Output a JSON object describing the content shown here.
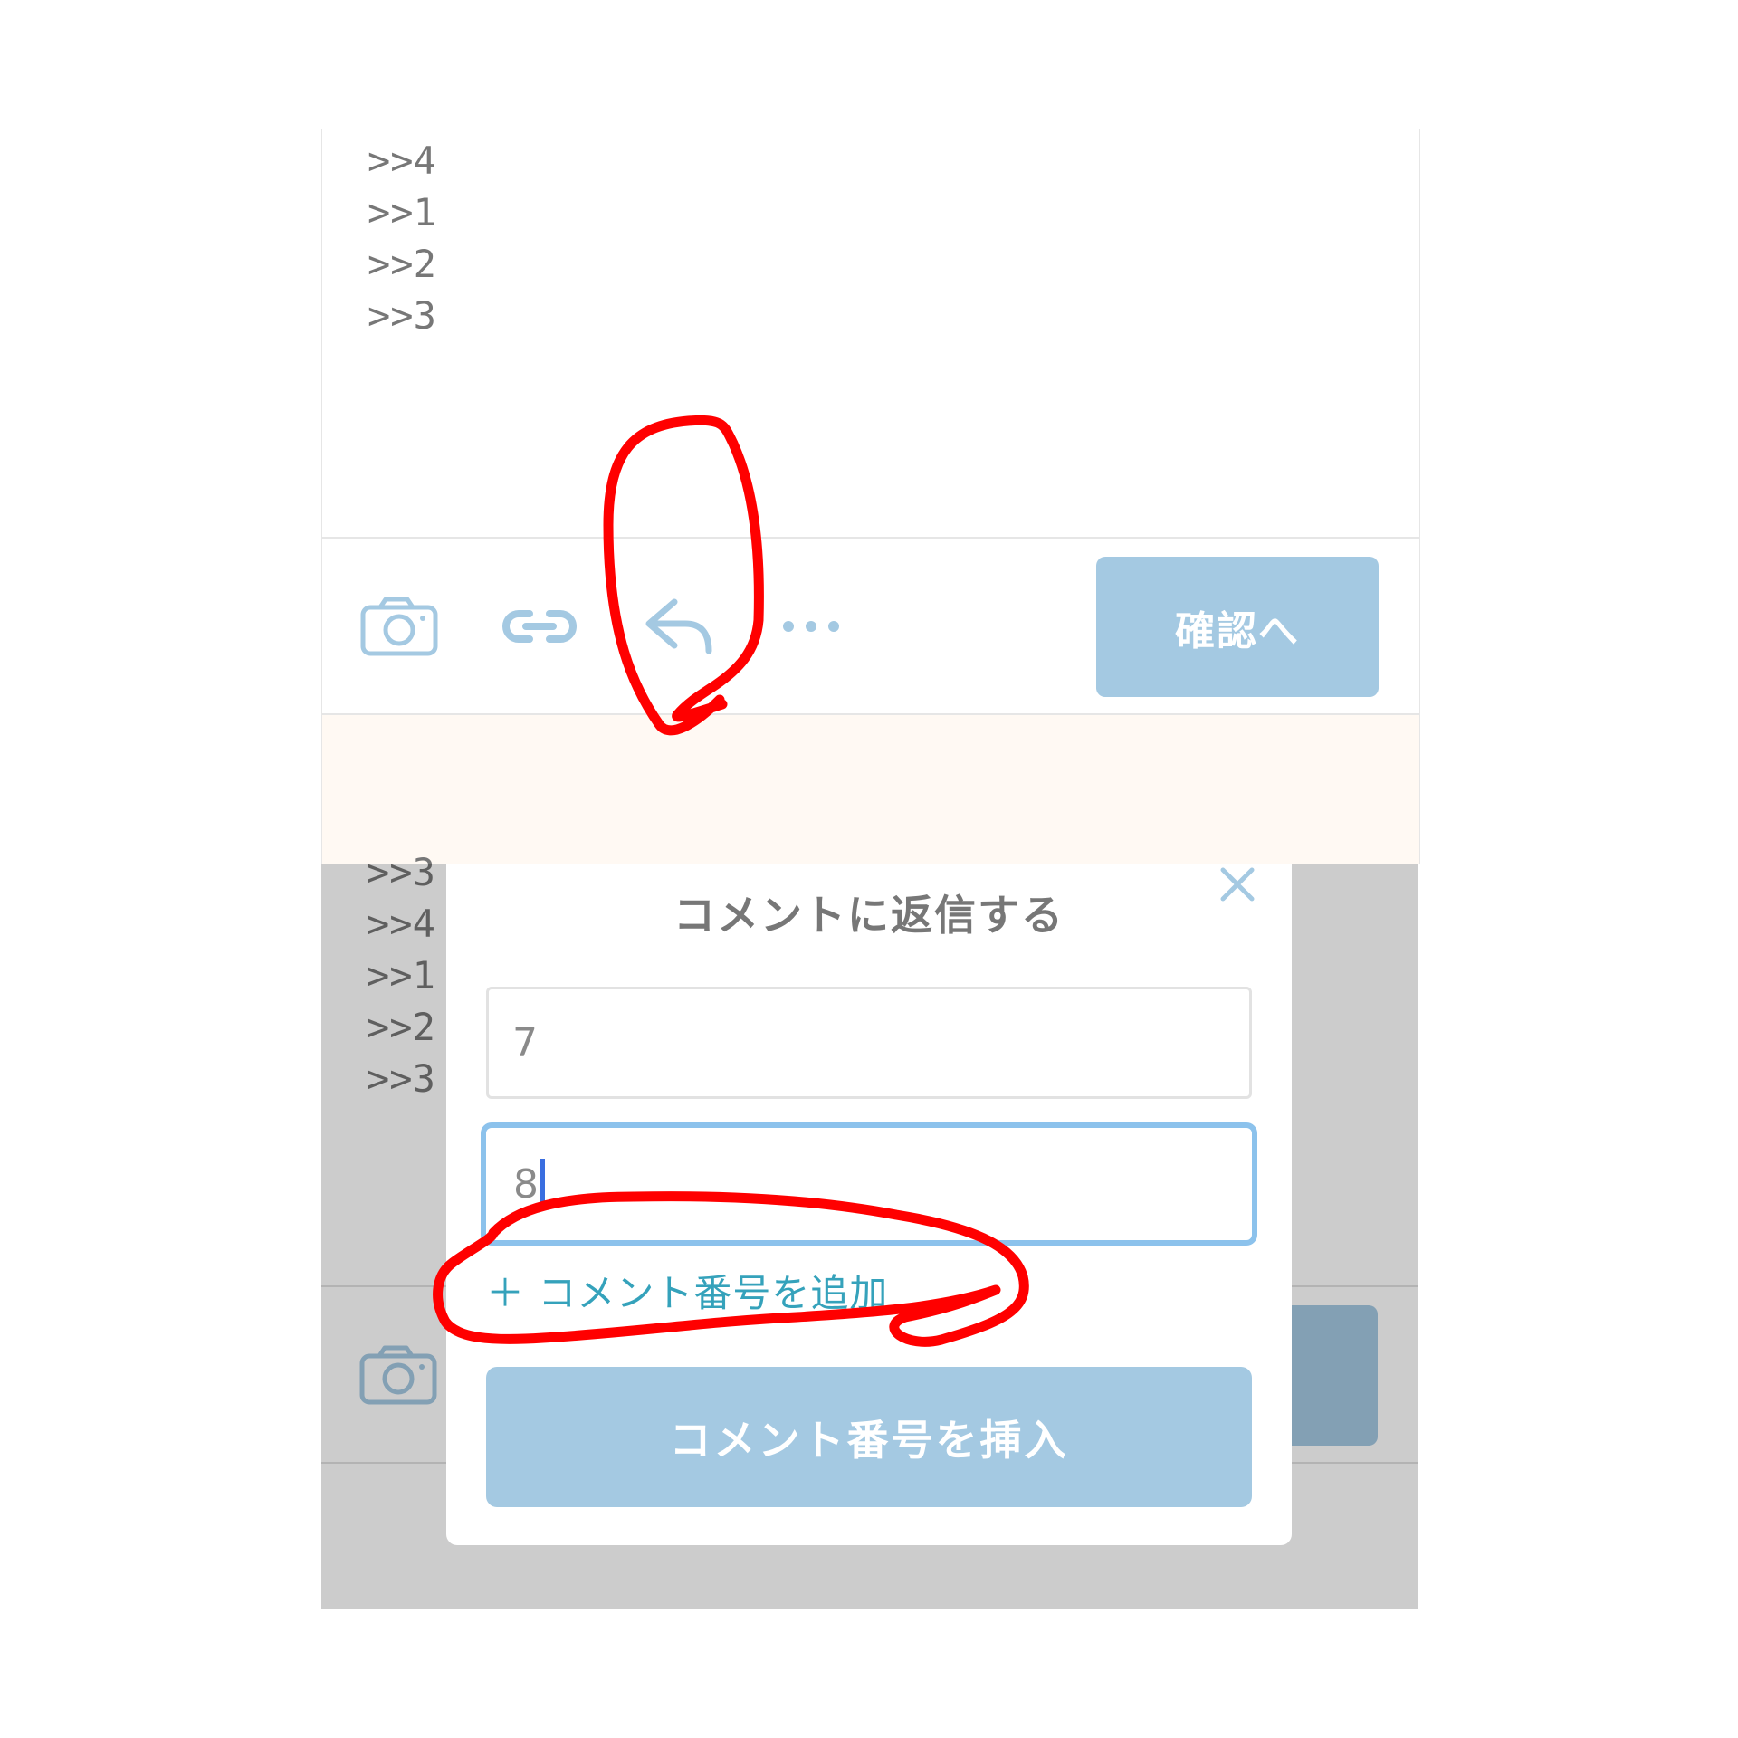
{
  "editor": {
    "reply_refs": [
      ">>4",
      ">>1",
      ">>2",
      ">>3"
    ],
    "toolbar": {
      "camera_icon": "camera-icon",
      "link_icon": "link-icon",
      "reply_icon": "reply-icon",
      "more_icon": "more-icon",
      "confirm_label": "確認へ"
    }
  },
  "background_editor": {
    "reply_refs": [
      ">>3",
      ">>4",
      ">>1",
      ">>2",
      ">>3"
    ]
  },
  "modal": {
    "title": "コメントに返信する",
    "fields": [
      {
        "value": "7"
      },
      {
        "value": "8"
      }
    ],
    "add_link": "＋ コメント番号を追加",
    "insert_label": "コメント番号を挿入"
  },
  "colors": {
    "accent_button": "#a4c9e2",
    "link_text": "#35a2bb",
    "annotation_red": "#ff0000",
    "focus_border": "#8cc2ec"
  }
}
